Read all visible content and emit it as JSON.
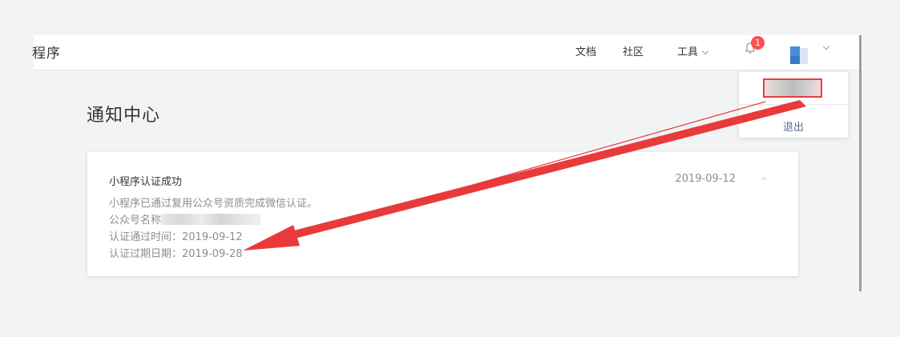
{
  "header": {
    "brand": "程序",
    "nav": [
      "文档",
      "社区",
      "工具"
    ],
    "notification_count": "1"
  },
  "account_menu": {
    "logout": "退出"
  },
  "page": {
    "title": "通知中心"
  },
  "notice": {
    "title": "小程序认证成功",
    "date": "2019-09-12",
    "body": {
      "line1": "小程序已通过复用公众号资质完成微信认证。",
      "account_label": "公众号名称",
      "passed_label": "认证通过时间：",
      "passed_value": "2019-09-12",
      "expire_label": "认证过期日期：",
      "expire_value": "2019-09-28"
    }
  },
  "colors": {
    "badge": "#fa5151",
    "link": "#576b95",
    "annotation_red": "#e83a3a"
  },
  "icons": [
    "bell-icon",
    "chevron-down-icon",
    "avatar",
    "collapse-icon"
  ]
}
